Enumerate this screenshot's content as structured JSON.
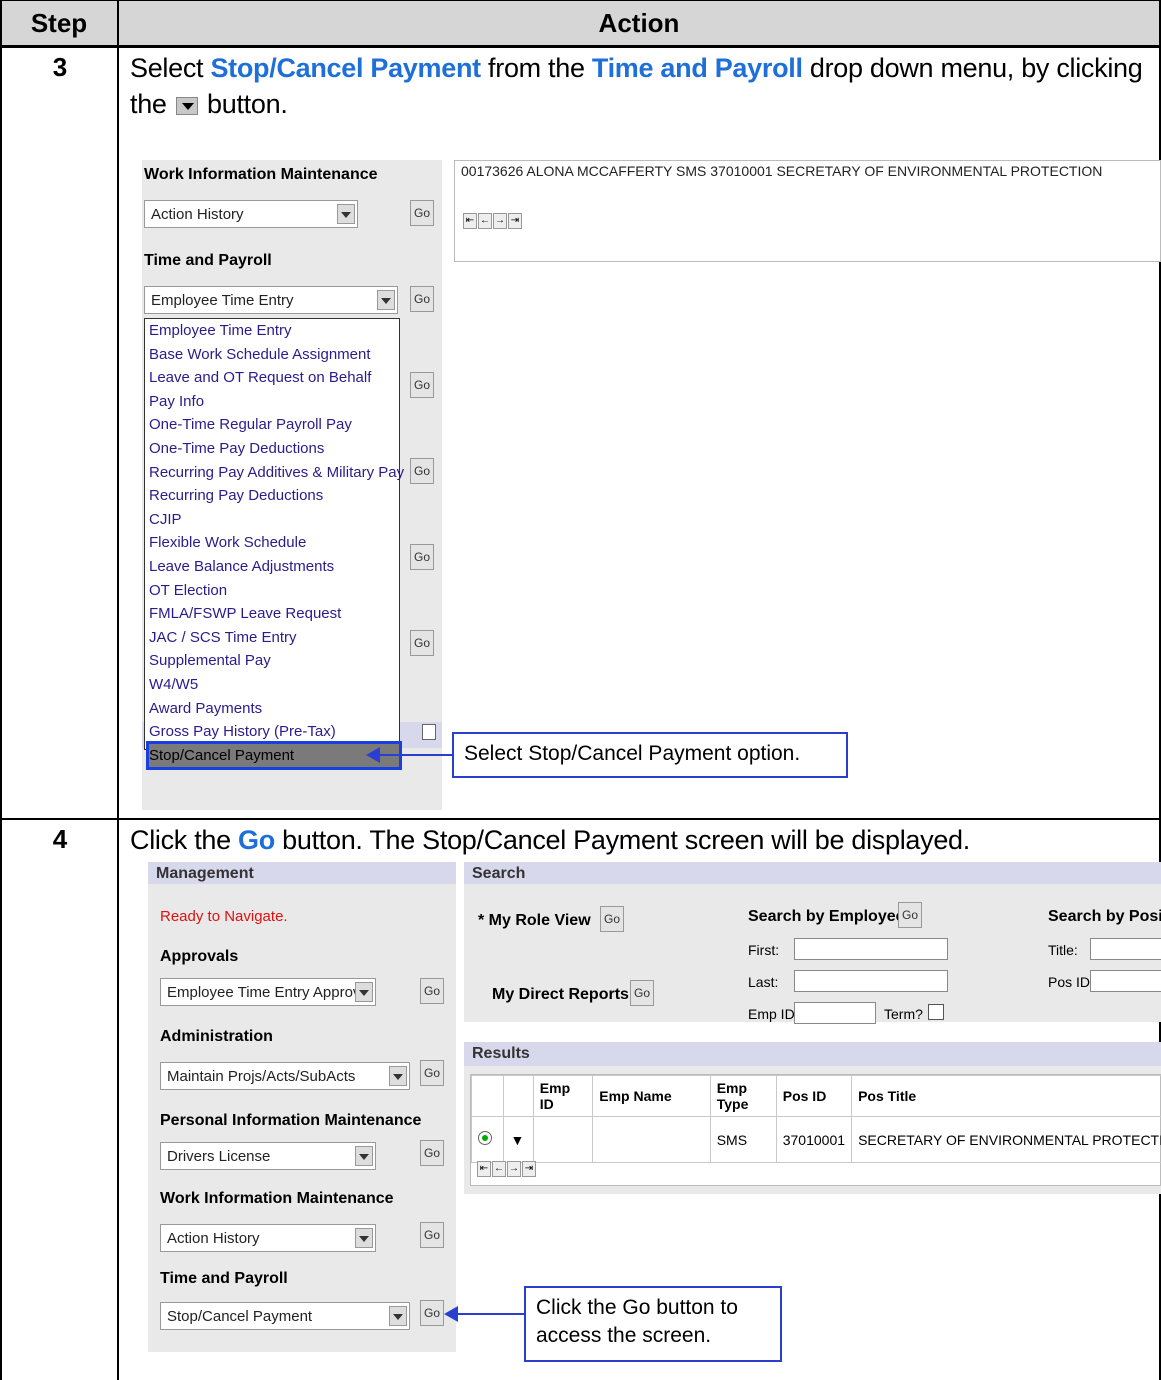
{
  "table": {
    "col_step": "Step",
    "col_action": "Action"
  },
  "step3": {
    "number": "3",
    "text_1": "Select ",
    "hl_1": "Stop/Cancel Payment",
    "text_2": " from the ",
    "hl_2": "Time and Payroll",
    "text_3": " drop down menu, by clicking",
    "text_4": "the ",
    "text_5": " button.",
    "shot": {
      "top_row": "00173626 ALONA MCCAFFERTY SMS 37010001 SECRETARY OF ENVIRONMENTAL PROTECTION",
      "work_info_label": "Work Information Maintenance",
      "work_info_value": "Action History",
      "time_payroll_label": "Time and Payroll",
      "time_payroll_value": "Employee Time Entry",
      "go": "Go",
      "options": [
        "Employee Time Entry",
        "Base Work Schedule Assignment",
        "Leave and OT Request on Behalf",
        "Pay Info",
        "One-Time Regular Payroll Pay",
        "One-Time Pay Deductions",
        "Recurring Pay Additives & Military Pay",
        "Recurring Pay Deductions",
        "CJIP",
        "Flexible Work Schedule",
        "Leave Balance Adjustments",
        "OT Election",
        "FMLA/FSWP Leave Request",
        "JAC / SCS Time Entry",
        "Supplemental Pay",
        "W4/W5",
        "Award Payments",
        "Gross Pay History (Pre-Tax)",
        "Stop/Cancel Payment"
      ],
      "callout": "Select Stop/Cancel Payment option."
    }
  },
  "step4": {
    "number": "4",
    "text_1": "Click the ",
    "hl_1": "Go",
    "text_2": " button.  The Stop/Cancel Payment screen will be displayed.",
    "shot": {
      "management_title": "Management",
      "search_title": "Search",
      "ready": "Ready to Navigate.",
      "approvals_label": "Approvals",
      "approvals_value": "Employee Time Entry Approval",
      "admin_label": "Administration",
      "admin_value": "Maintain Projs/Acts/SubActs",
      "personal_label": "Personal Information Maintenance",
      "personal_value": "Drivers License",
      "work_label": "Work Information Maintenance",
      "work_value": "Action History",
      "time_label": "Time and Payroll",
      "time_value": "Stop/Cancel Payment",
      "go": "Go",
      "my_role_view": "My Role View",
      "my_direct_reports": "My Direct Reports",
      "search_by_employee": "Search by Employee",
      "search_by_position": "Search by Positio",
      "first": "First:",
      "last": "Last:",
      "emp_id": "Emp ID:",
      "term": "Term?",
      "title": "Title:",
      "pos_id": "Pos ID:",
      "results_title": "Results",
      "columns": [
        "",
        "",
        "Emp ID",
        "Emp Name",
        "Emp Type",
        "Pos ID",
        "Pos Title"
      ],
      "row": {
        "emp_type": "SMS",
        "pos_id": "37010001",
        "pos_title": "SECRETARY OF ENVIRONMENTAL PROTECTION"
      },
      "callout_1": "Click the Go button to",
      "callout_2": "access the screen."
    }
  },
  "colors": {
    "highlight": "#1e6fd8",
    "callout_border": "#2a3fcf",
    "header_bg": "#d6d6d6"
  }
}
